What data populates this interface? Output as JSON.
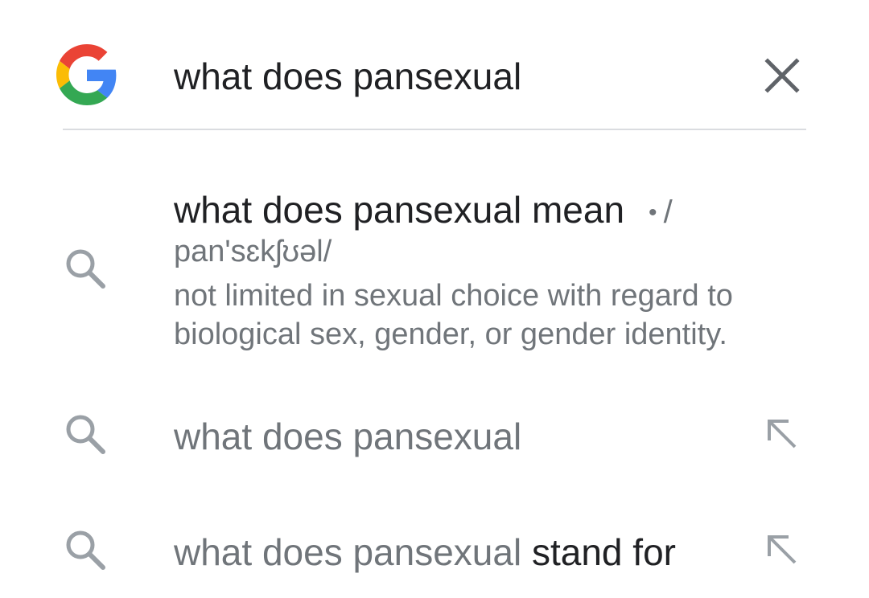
{
  "search": {
    "query": "what does pansexual",
    "icon_logo": "google-g-logo",
    "icon_clear": "close-icon"
  },
  "definition_suggestion": {
    "icon": "search-icon",
    "title": "what does pansexual mean",
    "dot": "•",
    "slash": "/",
    "pronunciation": "pan'sɛkʃʊəl/",
    "definition": "not limited in sexual choice with regard to biological sex, gender, or gender identity."
  },
  "suggestions": [
    {
      "icon": "search-icon",
      "prefix": "what does pansexual",
      "suffix": "",
      "fill_icon": "arrow-up-left-icon"
    },
    {
      "icon": "search-icon",
      "prefix": "what does pansexual",
      "suffix": "stand for",
      "fill_icon": "arrow-up-left-icon"
    }
  ],
  "colors": {
    "text_primary": "#202124",
    "text_secondary": "#70757a",
    "icon_gray": "#9aa0a6",
    "divider": "#dadce0",
    "google_blue": "#4285F4",
    "google_red": "#EA4335",
    "google_yellow": "#FBBC05",
    "google_green": "#34A853"
  }
}
